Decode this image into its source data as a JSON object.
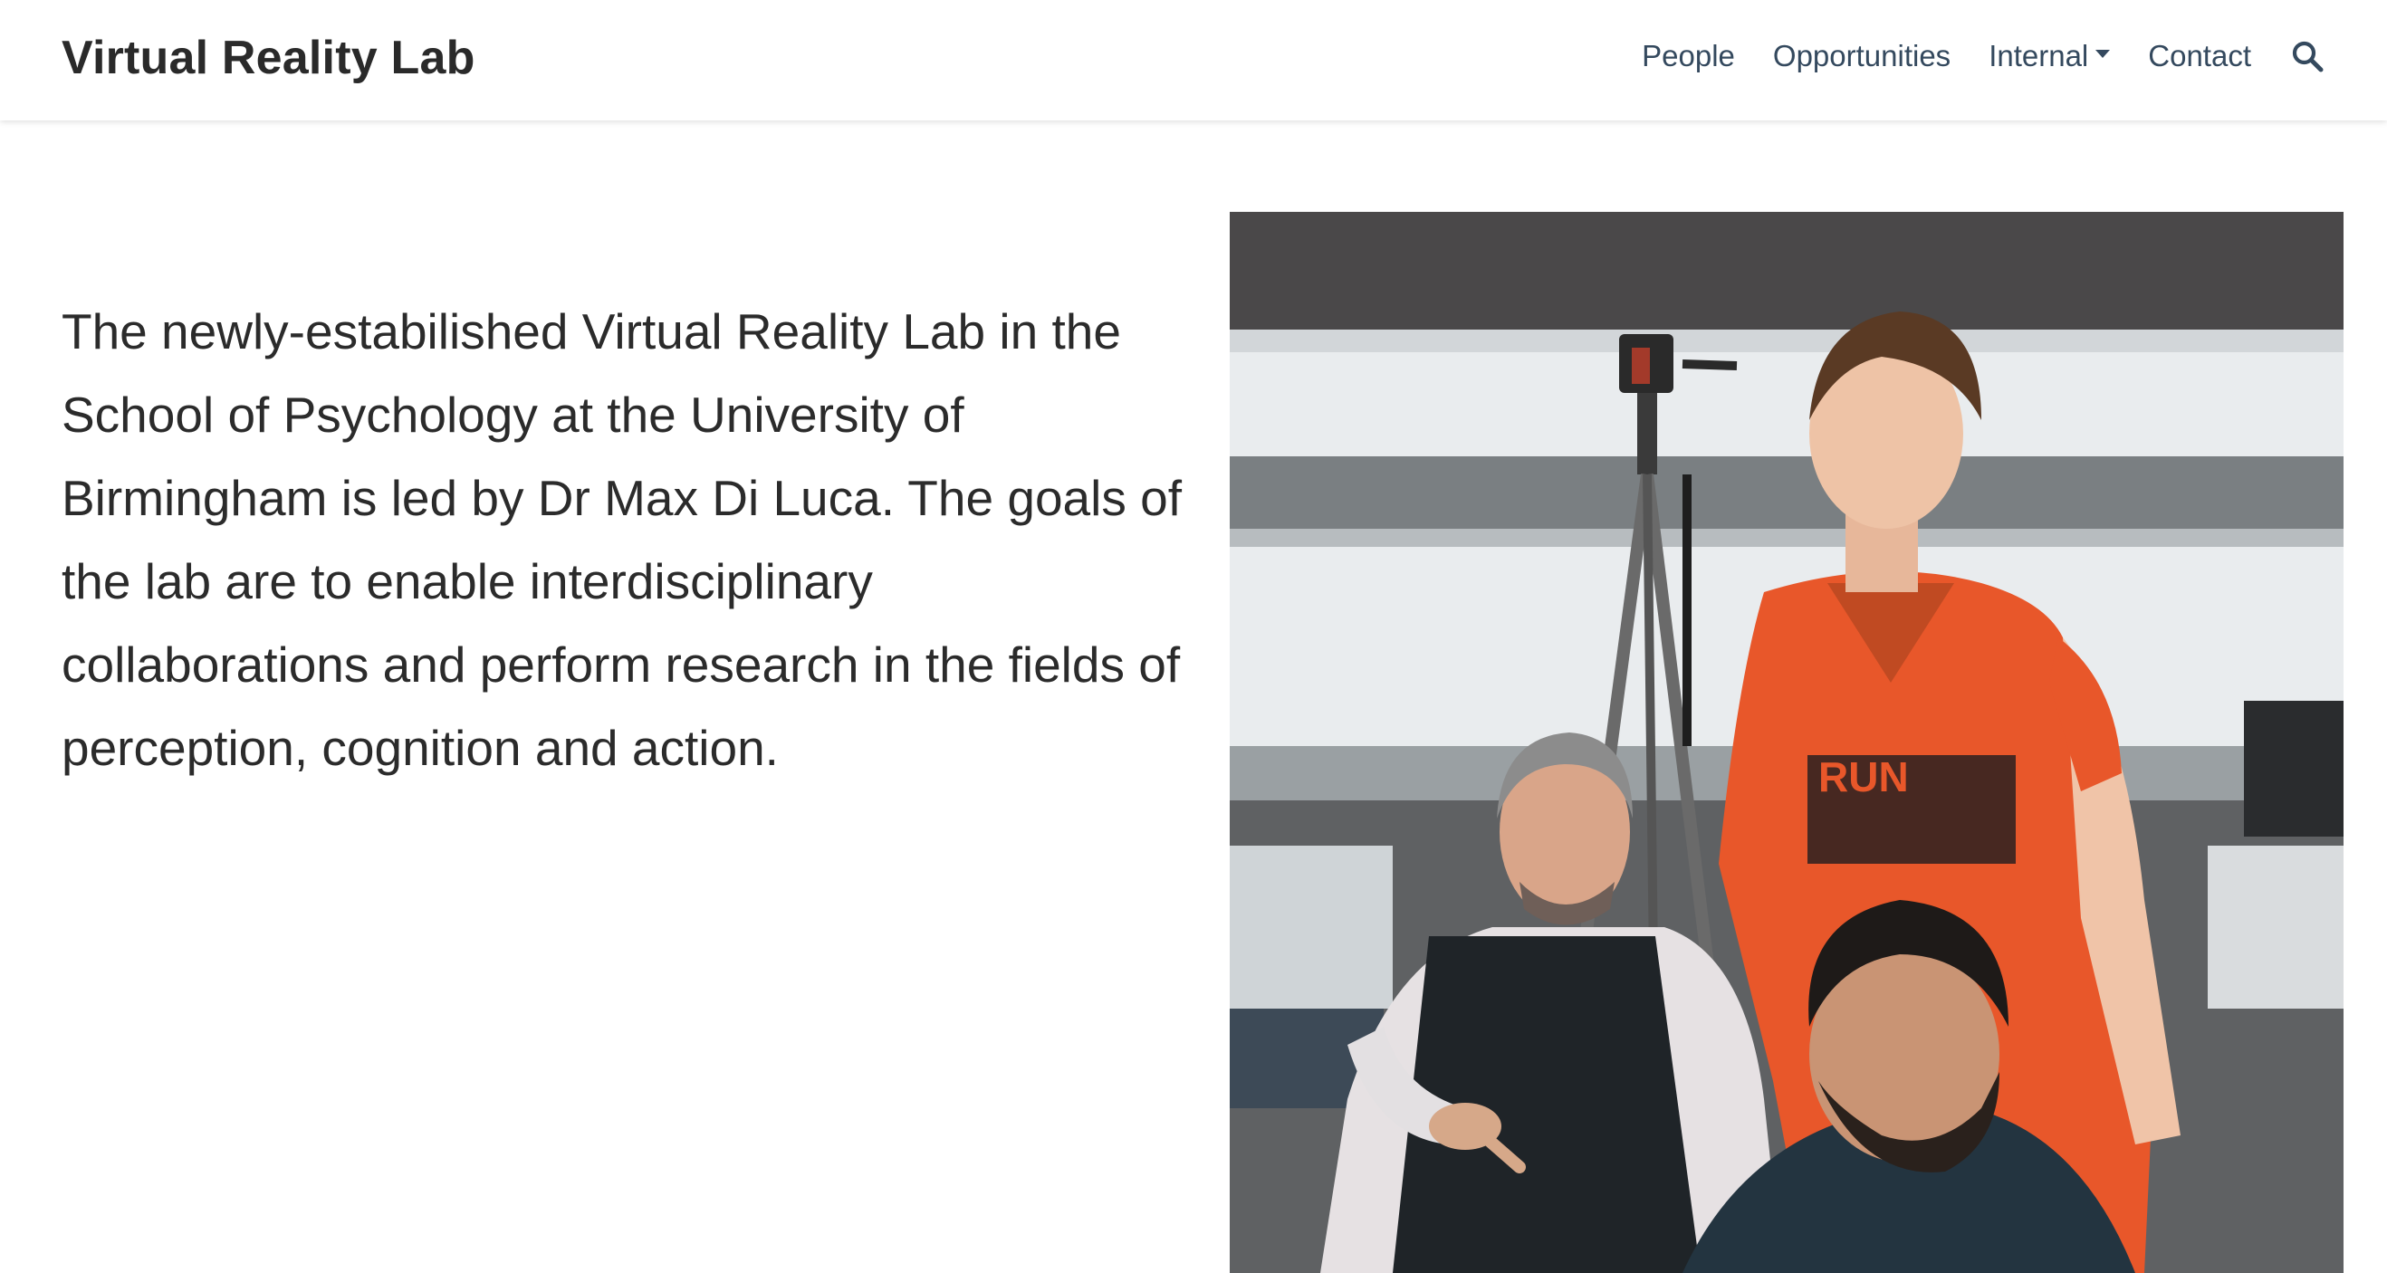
{
  "navbar": {
    "brand": "Virtual Reality Lab",
    "links": [
      {
        "label": "People"
      },
      {
        "label": "Opportunities"
      },
      {
        "label": "Internal",
        "has_dropdown": true
      },
      {
        "label": "Contact"
      }
    ],
    "search_icon": "search-icon"
  },
  "main": {
    "intro_text": "The newly-estabilished Virtual Reality Lab in the School of Psychology at the University of Birmingham is led by Dr Max Di Luca. The goals of the lab are to enable interdisciplinary collaborations and perform research in the fields of perception, cognition and action.",
    "photo_logo_text": "RUN"
  },
  "colors": {
    "nav_text": "#34495e",
    "body_text": "#2b2b2b",
    "brand_text": "#2a2a2a",
    "shirt_orange": "#e8572a"
  }
}
